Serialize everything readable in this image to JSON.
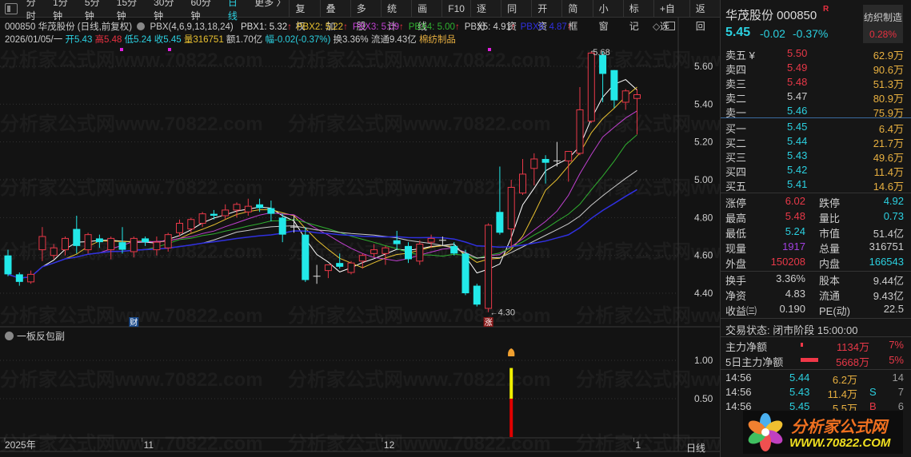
{
  "toolbar": {
    "periods": [
      "分时",
      "1分钟",
      "5分钟",
      "15分钟",
      "30分钟",
      "60分钟",
      "日线",
      "更多 〉"
    ],
    "active_period": "日线",
    "buttons": [
      "复权",
      "叠加",
      "多股",
      "统计",
      "画线",
      "F10",
      "逐分",
      "同资",
      "开资",
      "简框",
      "小窗",
      "标记",
      "+自选",
      "返回"
    ]
  },
  "info": {
    "title": "000850 华茂股份 (日线,前复权)",
    "indicator": "PBX(4,6,9,13,18,24)",
    "pbx": [
      {
        "label": "PBX1: 5.32",
        "color": "#dddddd"
      },
      {
        "label": "PBX2: 5.22",
        "color": "#e8c030"
      },
      {
        "label": "PBX3: 5.09",
        "color": "#c040d0"
      },
      {
        "label": "PBX4: 5.00",
        "color": "#30b030"
      },
      {
        "label": "PBX5: 4.91",
        "color": "#cccccc"
      },
      {
        "label": "PBX6: 4.87",
        "color": "#3030e0"
      }
    ],
    "date": "2026/01/05/一",
    "open": "开5.43",
    "high": "高5.48",
    "low": "低5.24",
    "close": "收5.45",
    "volume": "量316751",
    "amount": "额1.70亿",
    "change": "幅-0.02(-0.37%)",
    "turnover": "换3.36%",
    "float": "流通9.43亿",
    "sector": "棉纺制品"
  },
  "chart_data": {
    "type": "candlestick",
    "ylim": [
      4.25,
      5.75
    ],
    "yticks": [
      "5.60",
      "5.40",
      "5.20",
      "5.00",
      "4.80",
      "4.60",
      "4.40"
    ],
    "xticks": [
      {
        "label": "2025年",
        "index": 0
      },
      {
        "label": "11",
        "index": 12
      },
      {
        "label": "12",
        "index": 33
      },
      {
        "label": "1",
        "index": 55
      }
    ],
    "ohlc": [
      [
        4.6,
        4.63,
        4.49,
        4.5
      ],
      [
        4.5,
        4.51,
        4.44,
        4.46
      ],
      [
        4.46,
        4.52,
        4.45,
        4.5
      ],
      [
        4.63,
        4.75,
        4.57,
        4.7
      ],
      [
        4.6,
        4.66,
        4.58,
        4.64
      ],
      [
        4.63,
        4.7,
        4.6,
        4.69
      ],
      [
        4.74,
        4.81,
        4.61,
        4.65
      ],
      [
        4.63,
        4.72,
        4.61,
        4.71
      ],
      [
        4.69,
        4.71,
        4.64,
        4.67
      ],
      [
        4.63,
        4.7,
        4.58,
        4.69
      ],
      [
        4.67,
        4.75,
        4.61,
        4.63
      ],
      [
        4.62,
        4.7,
        4.59,
        4.69
      ],
      [
        4.69,
        4.7,
        4.65,
        4.67
      ],
      [
        4.63,
        4.7,
        4.6,
        4.67
      ],
      [
        4.64,
        4.72,
        4.62,
        4.71
      ],
      [
        4.72,
        4.79,
        4.7,
        4.77
      ],
      [
        4.74,
        4.8,
        4.72,
        4.79
      ],
      [
        4.77,
        4.83,
        4.75,
        4.82
      ],
      [
        4.82,
        4.84,
        4.79,
        4.81
      ],
      [
        4.81,
        4.87,
        4.79,
        4.84
      ],
      [
        4.84,
        4.88,
        4.8,
        4.87
      ],
      [
        4.83,
        4.9,
        4.81,
        4.86
      ],
      [
        4.87,
        4.9,
        4.83,
        4.85
      ],
      [
        4.85,
        4.89,
        4.78,
        4.82
      ],
      [
        4.8,
        4.82,
        4.67,
        4.71
      ],
      [
        4.75,
        4.81,
        4.72,
        4.75
      ],
      [
        4.71,
        4.75,
        4.46,
        4.47
      ],
      [
        4.49,
        4.55,
        4.45,
        4.49
      ],
      [
        4.52,
        4.55,
        4.48,
        4.55
      ],
      [
        4.56,
        4.61,
        4.53,
        4.54
      ],
      [
        4.51,
        4.57,
        4.5,
        4.56
      ],
      [
        4.57,
        4.61,
        4.53,
        4.6
      ],
      [
        4.61,
        4.66,
        4.59,
        4.63
      ],
      [
        4.61,
        4.65,
        4.55,
        4.64
      ],
      [
        4.68,
        4.73,
        4.63,
        4.66
      ],
      [
        4.65,
        4.67,
        4.56,
        4.58
      ],
      [
        4.57,
        4.68,
        4.55,
        4.66
      ],
      [
        4.67,
        4.71,
        4.64,
        4.69
      ],
      [
        4.68,
        4.7,
        4.65,
        4.68
      ],
      [
        4.65,
        4.67,
        4.6,
        4.61
      ],
      [
        4.61,
        4.63,
        4.39,
        4.4
      ],
      [
        4.44,
        4.45,
        4.33,
        4.34
      ],
      [
        4.32,
        4.77,
        4.3,
        4.76
      ],
      [
        4.83,
        5.07,
        4.71,
        4.72
      ],
      [
        4.74,
        5.0,
        4.64,
        4.96
      ],
      [
        4.93,
        5.11,
        4.92,
        5.03
      ],
      [
        5.06,
        5.14,
        4.97,
        5.11
      ],
      [
        5.11,
        5.13,
        4.98,
        5.09
      ],
      [
        5.1,
        5.2,
        5.07,
        5.1
      ],
      [
        5.1,
        5.15,
        4.99,
        5.15
      ],
      [
        5.14,
        5.49,
        5.13,
        5.37
      ],
      [
        5.31,
        5.68,
        5.3,
        5.67
      ],
      [
        5.66,
        5.68,
        5.41,
        5.56
      ],
      [
        5.58,
        5.58,
        5.38,
        5.42
      ],
      [
        5.41,
        5.48,
        5.37,
        5.47
      ],
      [
        5.43,
        5.48,
        5.24,
        5.45
      ]
    ],
    "ma_periods": [
      4,
      6,
      9,
      13,
      18,
      24
    ],
    "high_label": {
      "text": "5.68",
      "index": 51
    },
    "low_label": {
      "text": "4.30",
      "index": 42
    },
    "markers": [
      {
        "text": "财",
        "index": 11,
        "color": "#1a4a8a"
      },
      {
        "text": "涨",
        "index": 42,
        "color": "#8a1a1a"
      }
    ],
    "sub": {
      "name": "一板反包副",
      "yticks": [
        "1.00",
        "0.50"
      ],
      "ylim": [
        0,
        1.1
      ],
      "signal_index": 44,
      "red_to": 0.5,
      "yellow_to": 0.9
    },
    "period_label": "日线"
  },
  "quote": {
    "name": "华茂股份 000850",
    "badge": "R",
    "price": "5.45",
    "change": "-0.02",
    "pct": "-0.37%",
    "sector": "纺织制造",
    "sector_pct": "0.28%",
    "asks": [
      [
        "卖五 ¥",
        "5.50",
        "62.9万"
      ],
      [
        "卖四",
        "5.49",
        "90.6万"
      ],
      [
        "卖三",
        "5.48",
        "51.3万"
      ],
      [
        "卖二",
        "5.47",
        "80.9万"
      ],
      [
        "卖一",
        "5.46",
        "75.9万"
      ]
    ],
    "bids": [
      [
        "买一",
        "5.45",
        "6.4万"
      ],
      [
        "买二",
        "5.44",
        "21.7万"
      ],
      [
        "买三",
        "5.43",
        "49.6万"
      ],
      [
        "买四",
        "5.42",
        "11.4万"
      ],
      [
        "买五",
        "5.41",
        "14.6万"
      ]
    ],
    "stats": [
      [
        "涨停",
        "6.02",
        "跌停",
        "4.92"
      ],
      [
        "最高",
        "5.48",
        "量比",
        "0.73"
      ],
      [
        "最低",
        "5.24",
        "市值",
        "51.4亿"
      ],
      [
        "现量",
        "1917",
        "总量",
        "316751"
      ],
      [
        "外盘",
        "150208",
        "内盘",
        "166543"
      ]
    ],
    "stats2": [
      [
        "换手",
        "3.36%",
        "股本",
        "9.44亿"
      ],
      [
        "净资",
        "4.83",
        "流通",
        "9.43亿"
      ],
      [
        "收益㈢",
        "0.190",
        "PE(动)",
        "22.5"
      ]
    ],
    "status": "交易状态: 闭市阶段 15:00:00",
    "flows": [
      [
        "主力净额",
        "1134万",
        "7%"
      ],
      [
        "5日主力净额",
        "5668万",
        "5%"
      ]
    ],
    "ticks": [
      [
        "14:56",
        "5.44",
        "6.2万",
        "",
        "14"
      ],
      [
        "14:56",
        "5.43",
        "11.4万",
        "S",
        "7"
      ],
      [
        "14:56",
        "5.45",
        "5.5万",
        "B",
        "6"
      ]
    ]
  },
  "logo": {
    "title": "分析家公式网",
    "url": "WWW.70822.COM"
  },
  "watermark": "分析家公式网www.70822.com"
}
